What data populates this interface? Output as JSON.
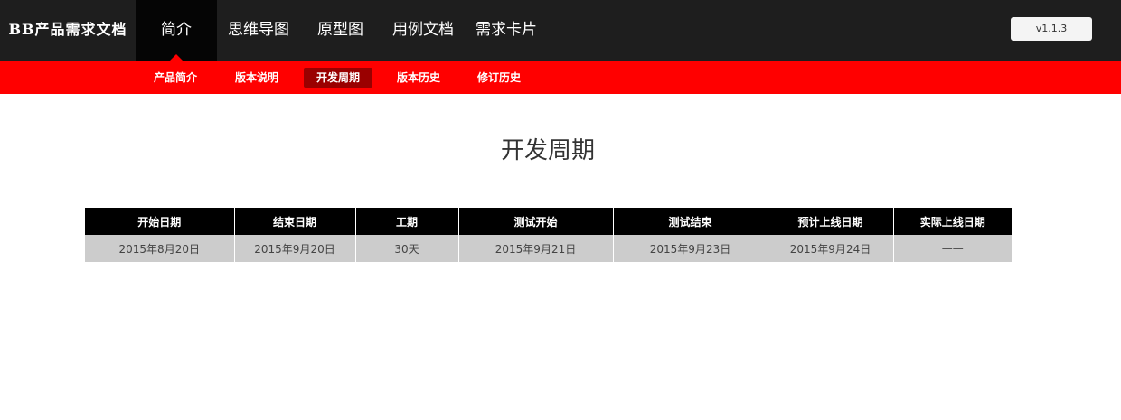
{
  "brand": "BB产品需求文档",
  "main_nav": [
    "简介",
    "思维导图",
    "原型图",
    "用例文档",
    "需求卡片"
  ],
  "version": "v1.1.3",
  "sub_nav": [
    "产品简介",
    "版本说明",
    "开发周期",
    "版本历史",
    "修订历史"
  ],
  "page_title": "开发周期",
  "table": {
    "headers": [
      "开始日期",
      "结束日期",
      "工期",
      "测试开始",
      "测试结束",
      "预计上线日期",
      "实际上线日期"
    ],
    "row": [
      "2015年8月20日",
      "2015年9月20日",
      "30天",
      "2015年9月21日",
      "2015年9月23日",
      "2015年9月24日",
      "——"
    ]
  },
  "colors": {
    "topbar": "#1e1e1e",
    "subbar": "#ff0000",
    "sub_active": "#9a0000",
    "table_header": "#000000",
    "table_cell": "#cccccc"
  }
}
